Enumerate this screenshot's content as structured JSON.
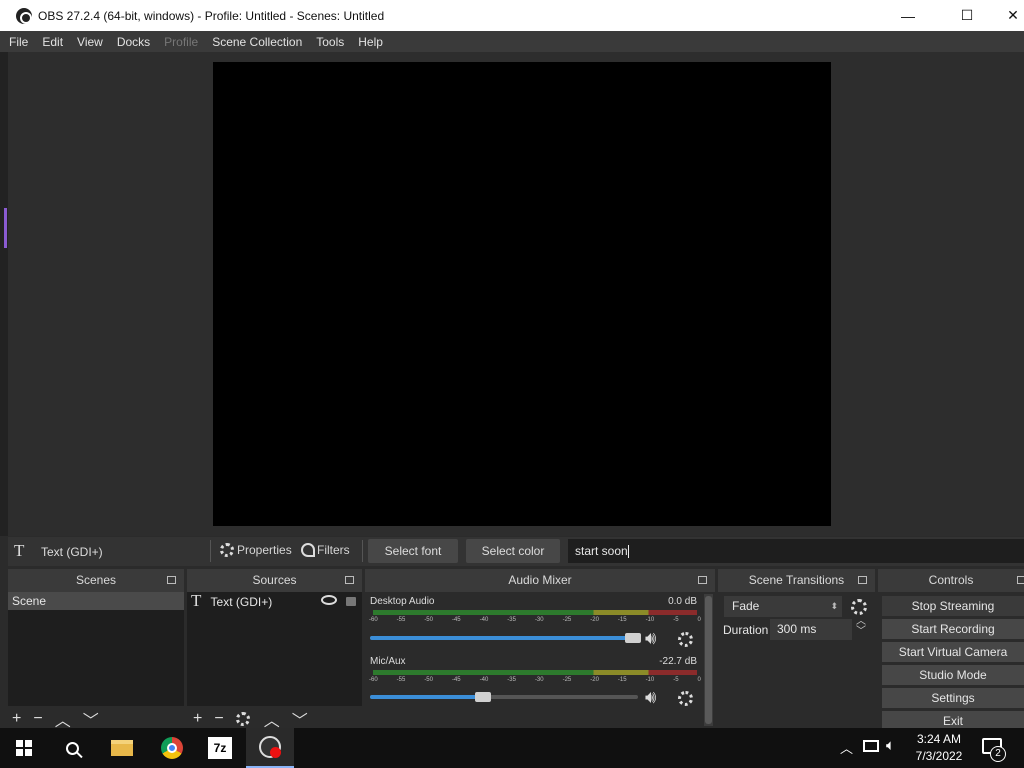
{
  "window": {
    "title": "OBS 27.2.4 (64-bit, windows) - Profile: Untitled - Scenes: Untitled",
    "minimize": "—",
    "maximize": "☐",
    "close": "✕"
  },
  "menu": [
    {
      "label": "File",
      "disabled": false
    },
    {
      "label": "Edit",
      "disabled": false
    },
    {
      "label": "View",
      "disabled": false
    },
    {
      "label": "Docks",
      "disabled": false
    },
    {
      "label": "Profile",
      "disabled": true
    },
    {
      "label": "Scene Collection",
      "disabled": false
    },
    {
      "label": "Tools",
      "disabled": false
    },
    {
      "label": "Help",
      "disabled": false
    }
  ],
  "source_toolbar": {
    "source_icon": "T",
    "source_name": "Text (GDI+)",
    "properties": "Properties",
    "filters": "Filters",
    "select_font": "Select font",
    "select_color": "Select color",
    "text_value": "start soon"
  },
  "scenes": {
    "title": "Scenes",
    "items": [
      "Scene"
    ]
  },
  "sources": {
    "title": "Sources",
    "items": [
      {
        "icon": "T",
        "name": "Text (GDI+)"
      }
    ]
  },
  "mixer": {
    "title": "Audio Mixer",
    "ticks": [
      "-60",
      "-55",
      "-50",
      "-45",
      "-40",
      "-35",
      "-30",
      "-25",
      "-20",
      "-15",
      "-10",
      "-5",
      "0"
    ],
    "channels": [
      {
        "name": "Desktop Audio",
        "db": "0.0 dB",
        "volume": 0.98
      },
      {
        "name": "Mic/Aux",
        "db": "-22.7 dB",
        "volume": 0.42
      }
    ]
  },
  "transitions": {
    "title": "Scene Transitions",
    "transition": "Fade",
    "duration_label": "Duration",
    "duration_value": "300 ms"
  },
  "controls": {
    "title": "Controls",
    "buttons": [
      "Stop Streaming",
      "Start Recording",
      "Start Virtual Camera",
      "Studio Mode",
      "Settings",
      "Exit"
    ]
  },
  "taskbar": {
    "time": "3:24 AM",
    "date": "7/3/2022",
    "notifications": "2",
    "sevenzip": "7z"
  }
}
